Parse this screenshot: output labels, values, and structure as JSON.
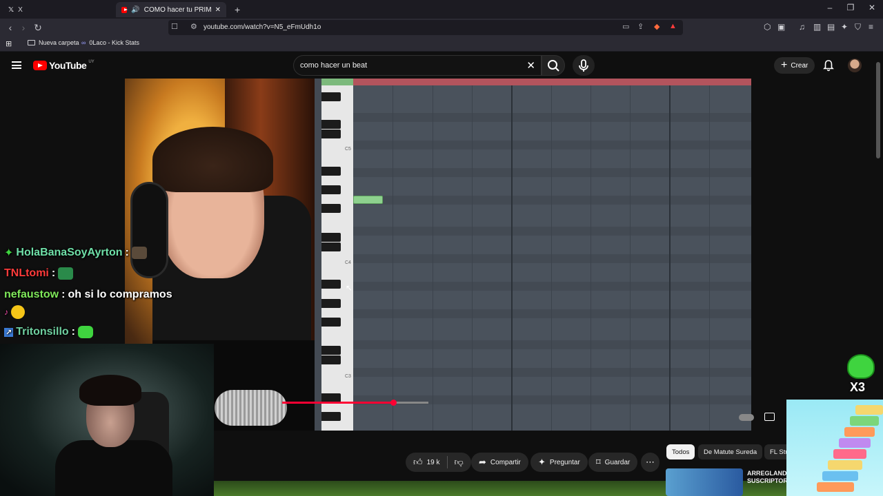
{
  "browser": {
    "tab_inactive_label": "X",
    "tab_active_title": "COMO hacer tu PRIMER BEAT",
    "new_tab": "+",
    "url": "youtube.com/watch?v=N5_eFmUdh1o",
    "bookmarks": [
      {
        "label": "Nueva carpeta",
        "icon": "folder-icon"
      },
      {
        "label": "0Laco - Kick Stats",
        "icon": "kick-icon"
      }
    ],
    "window_controls": [
      "–",
      "❐",
      "✕"
    ]
  },
  "youtube": {
    "logo_text": "YouTube",
    "country_code": "UY",
    "search_query": "como hacer un beat",
    "create_label": "Crear"
  },
  "video": {
    "piano_labels": [
      "C5",
      "C4",
      "C3"
    ],
    "progress_fraction": 0.43
  },
  "stream_chat": [
    {
      "user": "HolaBanaSoyAyrton",
      "sep": ":",
      "message": "",
      "color": "#6fe0a8"
    },
    {
      "user": "TNLtomi",
      "sep": ":",
      "message": "",
      "color": "#ff3b3b"
    },
    {
      "user": "nefaustow",
      "sep": ":",
      "message": "oh si lo compramos",
      "color": "#7fe85a"
    },
    {
      "user": "Tritonsillo",
      "sep": ":",
      "message": "",
      "color": "#6fd0a0"
    }
  ],
  "overlay": {
    "multiplier": "X3"
  },
  "actions": {
    "likes": "19 k",
    "share": "Compartir",
    "ask": "Preguntar",
    "save": "Guardar"
  },
  "chips": [
    "Todos",
    "De Matute Sureda",
    "FL Stu"
  ],
  "recommended": {
    "title": "ARREGLANDO SUSCRIPTORES"
  }
}
